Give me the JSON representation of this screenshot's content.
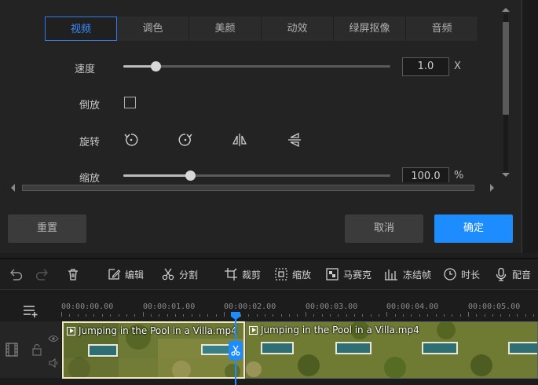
{
  "tabs": [
    {
      "label": "视频",
      "active": true
    },
    {
      "label": "调色",
      "active": false
    },
    {
      "label": "美颜",
      "active": false
    },
    {
      "label": "动效",
      "active": false
    },
    {
      "label": "绿屏抠像",
      "active": false
    },
    {
      "label": "音频",
      "active": false
    }
  ],
  "settings": {
    "speed": {
      "label": "速度",
      "value": "1.0",
      "unit": "X",
      "level": 0.12
    },
    "reverse": {
      "label": "倒放",
      "checked": false
    },
    "rotate": {
      "label": "旋转",
      "icons": [
        "rotate-left-icon",
        "rotate-right-icon",
        "flip-horizontal-icon",
        "flip-vertical-icon"
      ]
    },
    "scale": {
      "label": "缩放",
      "value": "100.0",
      "unit": "%",
      "level": 0.25
    }
  },
  "buttons": {
    "reset": "重置",
    "cancel": "取消",
    "confirm": "确定"
  },
  "toolbar": {
    "edit": "编辑",
    "split": "分割",
    "crop": "裁剪",
    "zoom": "缩放",
    "mosaic": "马赛克",
    "freeze": "冻结帧",
    "duration": "时长",
    "dub": "配音"
  },
  "timeline": {
    "ticks": [
      "00:00:00.00",
      "00:00:01.00",
      "00:00:02.00",
      "00:00:03.00",
      "00:00:04.00",
      "00:00:05.00"
    ],
    "clips": [
      {
        "name": "Jumping in the Pool in a Villa.mp4"
      },
      {
        "name": "Jumping in the Pool in a Villa.mp4"
      }
    ]
  },
  "colors": {
    "accent": "#1d8cff",
    "panel": "#232323",
    "clip_border": "#eadcb0"
  }
}
